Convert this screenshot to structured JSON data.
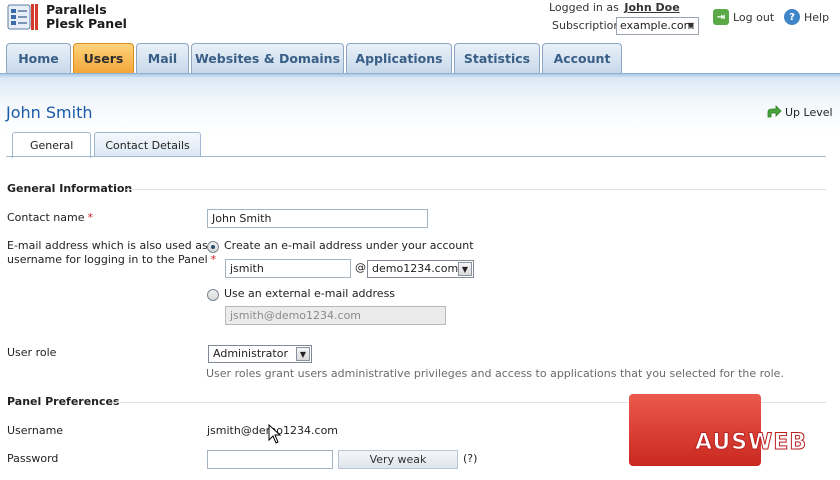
{
  "app": {
    "brand_line1": "Parallels",
    "brand_line2": "Plesk Panel",
    "logged_in_label": "Logged in as",
    "logged_in_user": "John Doe",
    "subscription_label": "Subscription",
    "subscription_value": "example.com",
    "logout_label": "Log out",
    "help_label": "Help"
  },
  "nav": {
    "tabs": [
      {
        "label": "Home",
        "active": false
      },
      {
        "label": "Users",
        "active": true
      },
      {
        "label": "Mail",
        "active": false
      },
      {
        "label": "Websites & Domains",
        "active": false
      },
      {
        "label": "Applications",
        "active": false
      },
      {
        "label": "Statistics",
        "active": false
      },
      {
        "label": "Account",
        "active": false
      }
    ]
  },
  "page": {
    "title": "John Smith",
    "up_level_label": "Up Level",
    "subtabs": [
      {
        "label": "General",
        "active": true
      },
      {
        "label": "Contact Details",
        "active": false
      }
    ]
  },
  "general_info": {
    "section_title": "General Information",
    "contact_name_label": "Contact name",
    "contact_name_value": "John Smith",
    "email_label_line1": "E-mail address which is also used as a",
    "email_label_line2": "username for logging in to the Panel",
    "create_email_option": "Create an e-mail address under your account",
    "create_email_selected": true,
    "email_local_part": "jsmith",
    "at_sign": "@",
    "email_domain": "demo1234.com",
    "external_email_option": "Use an external e-mail address",
    "external_email_placeholder": "jsmith@demo1234.com",
    "user_role_label": "User role",
    "user_role_value": "Administrator",
    "user_role_hint": "User roles grant users administrative privileges and access to applications that you selected for the role."
  },
  "panel_prefs": {
    "section_title": "Panel Preferences",
    "username_label": "Username",
    "username_value": "jsmith@demo1234.com",
    "password_label": "Password",
    "password_strength": "Very weak",
    "password_help": "(?)"
  },
  "watermark": {
    "text": "AUSWEB"
  },
  "colors": {
    "active_tab": "#f3a63a",
    "tab_text": "#3a5f86",
    "title_blue": "#1a5aa8",
    "required_star": "#d2232a",
    "watermark_red": "#d8392f"
  }
}
